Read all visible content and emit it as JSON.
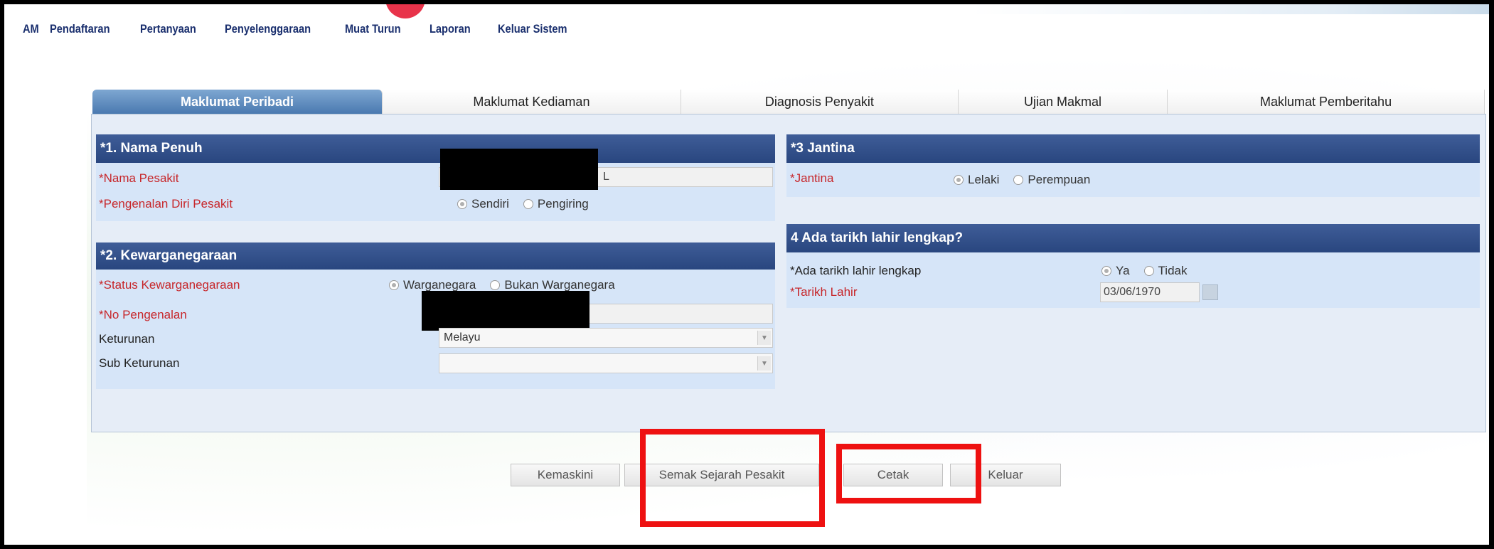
{
  "menu": {
    "items": [
      "AM",
      "Pendaftaran",
      "Pertanyaan",
      "Penyelenggaraan",
      "Muat Turun",
      "Laporan",
      "Keluar Sistem"
    ]
  },
  "tabs": [
    {
      "label": "Maklumat Peribadi",
      "active": true
    },
    {
      "label": "Maklumat Kediaman",
      "active": false
    },
    {
      "label": "Diagnosis Penyakit",
      "active": false
    },
    {
      "label": "Ujian Makmal",
      "active": false
    },
    {
      "label": "Maklumat Pemberitahu",
      "active": false
    }
  ],
  "section1": {
    "title": "*1. Nama Penuh",
    "nama_label": "*Nama Pesakit",
    "nama_value_visible": "L",
    "pengenalan_label": "*Pengenalan Diri Pesakit",
    "pengenalan_options": [
      "Sendiri",
      "Pengiring"
    ],
    "pengenalan_selected": "Sendiri"
  },
  "section2": {
    "title": "*2. Kewarganegaraan",
    "status_label": "*Status Kewarganegaraan",
    "status_options": [
      "Warganegara",
      "Bukan Warganegara"
    ],
    "status_selected": "Warganegara",
    "nopengenalan_label": "*No Pengenalan",
    "keturunan_label": "Keturunan",
    "keturunan_value": "Melayu",
    "subketurunan_label": "Sub Keturunan",
    "subketurunan_value": ""
  },
  "section3": {
    "title": "*3 Jantina",
    "jantina_label": "*Jantina",
    "jantina_options": [
      "Lelaki",
      "Perempuan"
    ],
    "jantina_selected": "Lelaki"
  },
  "section4": {
    "title": "4 Ada tarikh lahir lengkap?",
    "ada_label": "*Ada tarikh lahir lengkap",
    "ada_options": [
      "Ya",
      "Tidak"
    ],
    "ada_selected": "Ya",
    "tarikh_label": "*Tarikh Lahir",
    "tarikh_value": "03/06/1970"
  },
  "buttons": {
    "kemaskini": "Kemaskini",
    "semak": "Semak Sejarah Pesakit",
    "cetak": "Cetak",
    "keluar": "Keluar"
  },
  "colors": {
    "section_header": "#2f4d8a",
    "section_body": "#d6e5f8",
    "required_label": "#c7262a",
    "highlight": "#ee1111",
    "active_tab": "#5a87bd"
  }
}
